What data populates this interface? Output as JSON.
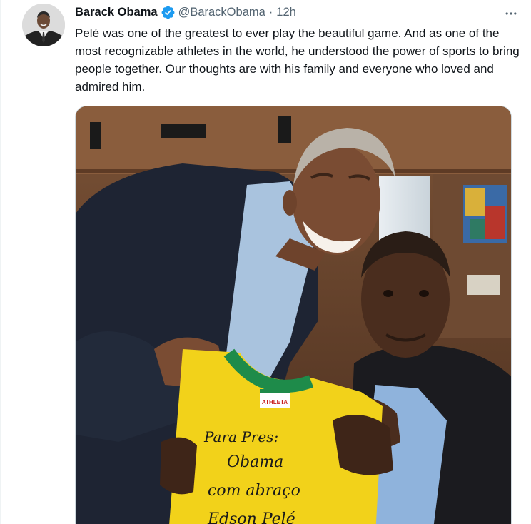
{
  "tweet": {
    "author_name": "Barack Obama",
    "handle": "@BarackObama",
    "separator": "·",
    "time": "12h",
    "text": "Pelé was one of the greatest to ever play the beautiful game. And as one of the most recognizable athletes in the world, he understood the power of sports to bring people together. Our thoughts are with his family and everyone who loved and admired him.",
    "verified": true
  },
  "media": {
    "jersey_inscription": [
      "Para Pres:",
      "Obama",
      "com abraço",
      "Edson Pelé"
    ],
    "jersey_tag": "ATHLETA"
  },
  "colors": {
    "verified_blue": "#1d9bf0",
    "secondary_text": "#536471",
    "primary_text": "#0f1419"
  },
  "icons": {
    "verified": "verified-badge-icon",
    "more": "more-options-icon"
  }
}
